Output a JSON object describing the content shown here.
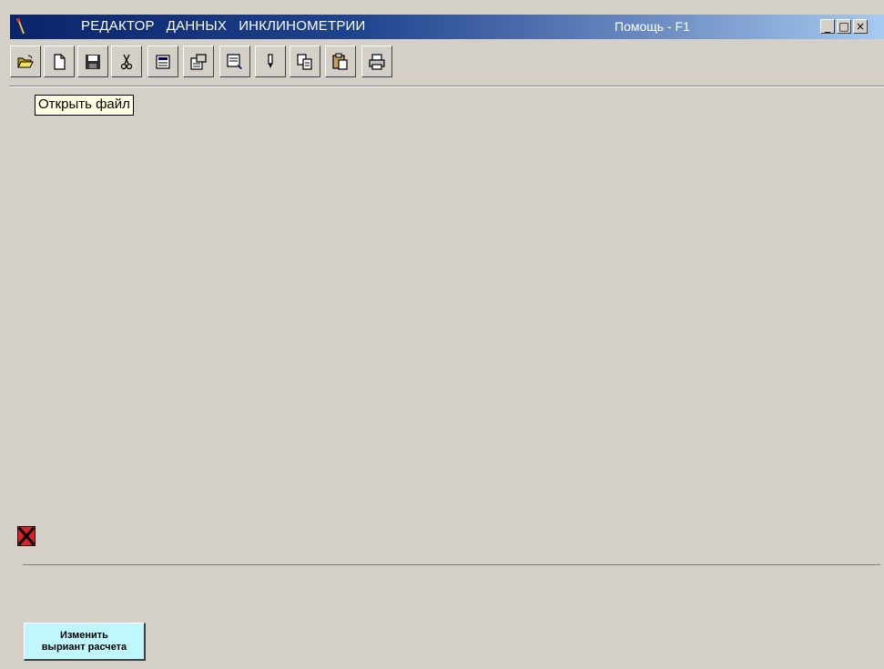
{
  "window": {
    "title": "РЕДАКТОР   ДАННЫХ   ИНКЛИНОМЕТРИИ",
    "help": "Помощь - F1",
    "controls": {
      "minimize": "_",
      "maximize": "□",
      "close": "×"
    }
  },
  "toolbar": {
    "buttons": [
      {
        "icon": "open-folder-icon"
      },
      {
        "icon": "new-document-icon"
      },
      {
        "icon": "save-icon"
      },
      {
        "icon": "cut-icon"
      },
      {
        "icon": "import-icon"
      },
      {
        "icon": "properties-icon"
      },
      {
        "icon": "edit-data-icon"
      },
      {
        "icon": "pen-icon"
      },
      {
        "icon": "copy-icon"
      },
      {
        "icon": "paste-icon"
      },
      {
        "icon": "print-icon"
      }
    ]
  },
  "tooltip": "Открыть файл",
  "status_icon": "red-x-icon",
  "action_button": {
    "line1": "Изменить",
    "line2": "выриант расчета"
  },
  "colors": {
    "background": "#d4d0c8",
    "title_start": "#0a246a",
    "title_end": "#a6caf0",
    "tooltip_bg": "#ffffe1",
    "action_button_bg": "#bff7ff"
  }
}
